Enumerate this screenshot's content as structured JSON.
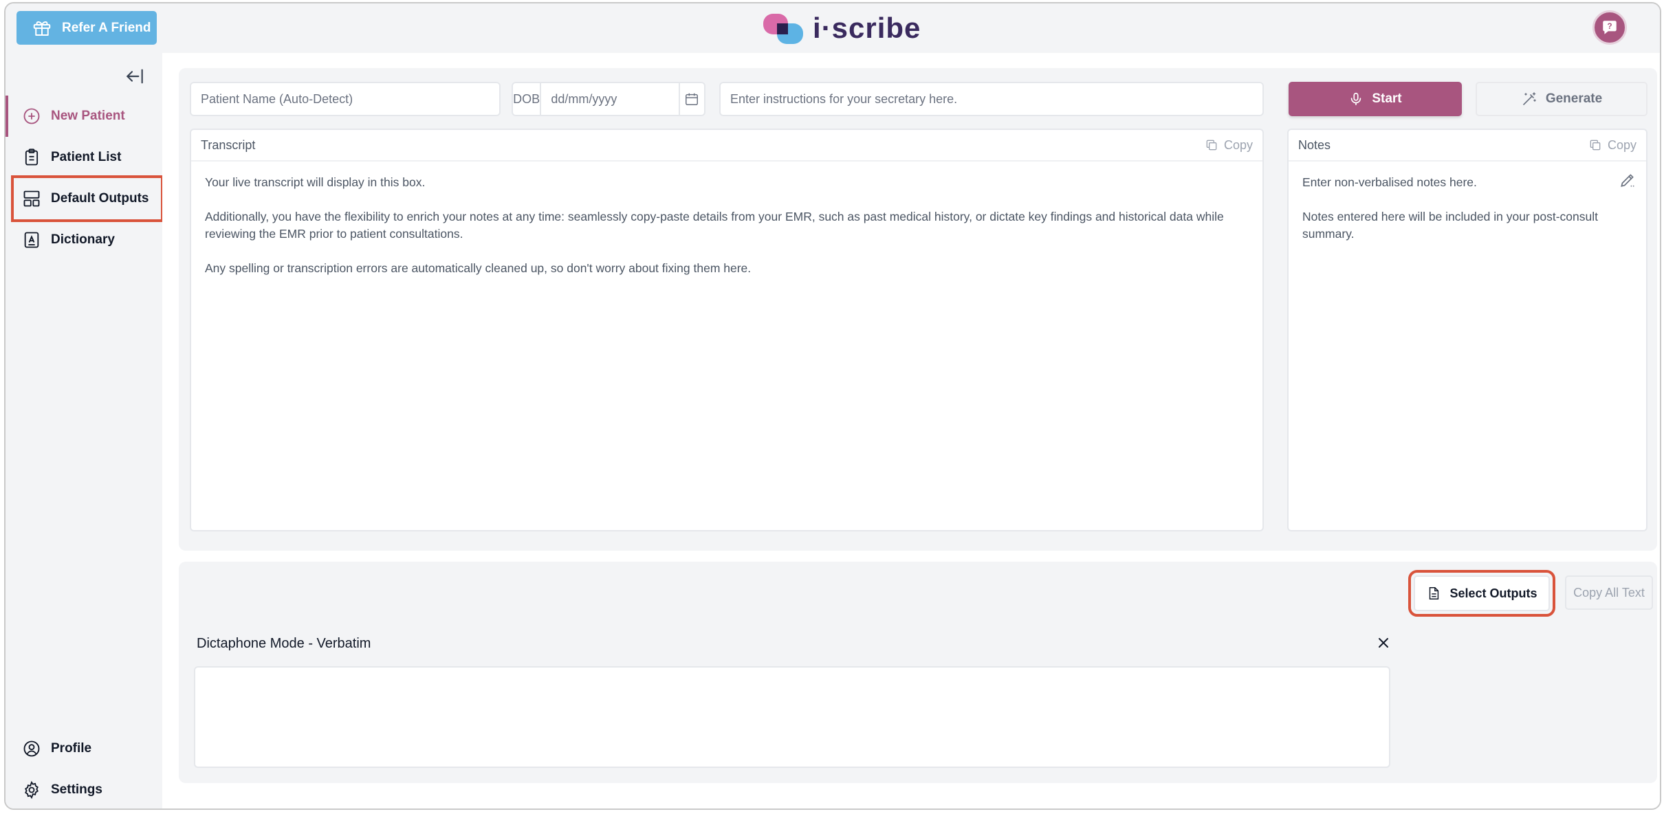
{
  "topbar": {
    "refer_label": "Refer A Friend",
    "logo_text": "i·scribe",
    "help_icon": "help-chat-icon"
  },
  "sidebar": {
    "collapse_icon": "collapse-left-icon",
    "items": [
      {
        "label": "New Patient",
        "icon": "plus-circle-icon",
        "active": true
      },
      {
        "label": "Patient List",
        "icon": "clipboard-icon"
      },
      {
        "label": "Default Outputs",
        "icon": "layout-icon"
      },
      {
        "label": "Dictionary",
        "icon": "dictionary-icon"
      }
    ],
    "bottom_items": [
      {
        "label": "Profile",
        "icon": "user-circle-icon"
      },
      {
        "label": "Settings",
        "icon": "gear-icon"
      }
    ]
  },
  "form": {
    "patient_placeholder": "Patient Name (Auto-Detect)",
    "dob_label": "DOB",
    "dob_placeholder": "dd/mm/yyyy",
    "instructions_placeholder": "Enter instructions for your secretary here.",
    "start_label": "Start",
    "generate_label": "Generate"
  },
  "transcript": {
    "title": "Transcript",
    "copy_label": "Copy",
    "paragraphs": [
      "Your live transcript will display in this box.",
      "Additionally, you have the flexibility to enrich your notes at any time: seamlessly copy-paste details from your EMR, such as past medical history, or dictate key findings and historical data while reviewing the EMR prior to patient consultations.",
      "Any spelling or transcription errors are automatically cleaned up, so don't worry about fixing them here."
    ]
  },
  "notes": {
    "title": "Notes",
    "copy_label": "Copy",
    "paragraphs": [
      "Enter non-verbalised notes here.",
      "Notes entered here will be included in your post-consult summary."
    ]
  },
  "outputs": {
    "select_label": "Select Outputs",
    "copy_all_label": "Copy All Text",
    "output_title": "Dictaphone Mode - Verbatim"
  },
  "colors": {
    "brand": "#a8557f",
    "refer": "#63b3e2",
    "highlight": "#d9533b"
  }
}
